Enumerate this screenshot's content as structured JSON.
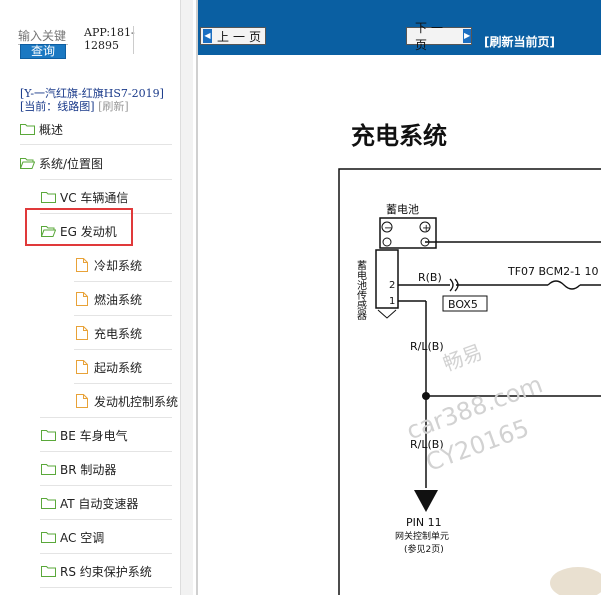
{
  "search": {
    "placeholder": "输入关键",
    "button_label": "查询"
  },
  "app": {
    "label": "APP:181-12895"
  },
  "vehicle": {
    "line": "[Y-一汽红旗-红旗HS7-2019]",
    "current_label": "[当前：线路图]",
    "refresh_label": "[刷新]"
  },
  "tree": {
    "items": [
      {
        "label": "概述",
        "icon": "folder-icon",
        "level": 0
      },
      {
        "label": "系统/位置图",
        "icon": "folder-open-icon",
        "level": 0
      },
      {
        "label": "VC 车辆通信",
        "icon": "folder-icon",
        "level": 1
      },
      {
        "label": "EG 发动机",
        "icon": "folder-open-icon",
        "level": 1,
        "selected": true
      },
      {
        "label": "冷却系统",
        "icon": "document-icon",
        "level": 2
      },
      {
        "label": "燃油系统",
        "icon": "document-icon",
        "level": 2
      },
      {
        "label": "充电系统",
        "icon": "document-icon",
        "level": 2
      },
      {
        "label": "起动系统",
        "icon": "document-icon",
        "level": 2
      },
      {
        "label": "发动机控制系统",
        "icon": "document-icon",
        "level": 2
      },
      {
        "label": "BE 车身电气",
        "icon": "folder-icon",
        "level": 1
      },
      {
        "label": "BR 制动器",
        "icon": "folder-icon",
        "level": 1
      },
      {
        "label": "AT 自动变速器",
        "icon": "folder-icon",
        "level": 1
      },
      {
        "label": "AC 空调",
        "icon": "folder-icon",
        "level": 1
      },
      {
        "label": "RS 约束保护系统",
        "icon": "folder-icon",
        "level": 1
      }
    ]
  },
  "toolbar": {
    "prev_label": "上一页",
    "next_label": "下一页",
    "refresh_label": "[刷新当前页]"
  },
  "page": {
    "title": "充电系统"
  },
  "diagram": {
    "battery_label": "蓄电池",
    "sensor_label": "蓄电池传感器",
    "minus_symbol": "−",
    "plus_symbol": "+",
    "pin2": "2",
    "pin1": "1",
    "wire_rb": "R(B)",
    "fuse_label": "TF07 BCM2-1 10",
    "box_label": "BOX5",
    "wire_rlb_1": "R/L(B)",
    "wire_rlb_2": "R/L(B)",
    "pin11": "PIN 11",
    "gateway": "网关控制单元",
    "see_page": "(参见2页)"
  },
  "watermark": {
    "line1": "畅易",
    "line2": "car388.com",
    "line3": "CY20165"
  },
  "colors": {
    "toolbar_bg": "#0a5fa2",
    "search_button": "#1a78c2",
    "highlight": "#e0393a",
    "folder_green": "#5aa83a",
    "doc_orange": "#e8a238"
  }
}
